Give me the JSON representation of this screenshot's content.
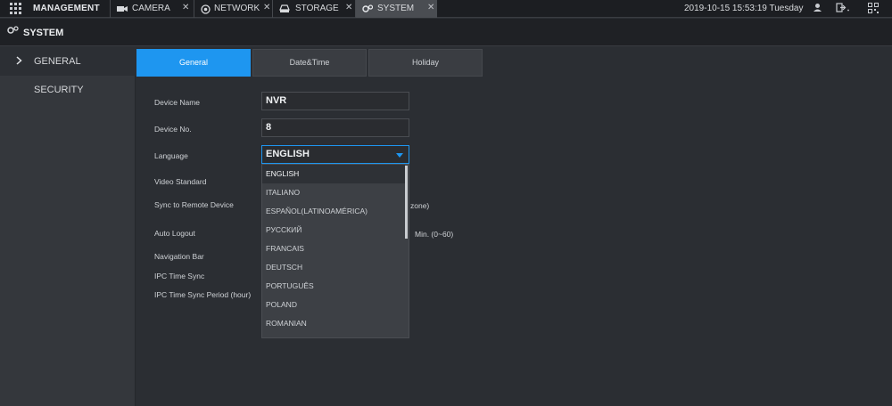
{
  "topbar": {
    "title": "MANAGEMENT",
    "tabs": [
      {
        "label": "CAMERA",
        "icon": "camera-icon",
        "close": "✕"
      },
      {
        "label": "NETWORK",
        "icon": "network-icon",
        "close": "✕"
      },
      {
        "label": "STORAGE",
        "icon": "storage-icon",
        "close": "✕"
      },
      {
        "label": "SYSTEM",
        "icon": "system-icon",
        "close": "✕",
        "active": true
      }
    ],
    "datetime": "2019-10-15 15:53:19 Tuesday"
  },
  "subbar": {
    "title": "SYSTEM"
  },
  "sidebar": {
    "items": [
      {
        "label": "GENERAL",
        "selected": true
      },
      {
        "label": "SECURITY",
        "selected": false
      }
    ]
  },
  "content_tabs": [
    {
      "label": "General",
      "active": true
    },
    {
      "label": "Date&Time",
      "active": false
    },
    {
      "label": "Holiday",
      "active": false
    }
  ],
  "form": {
    "device_name_label": "Device Name",
    "device_name_value": "NVR",
    "device_no_label": "Device No.",
    "device_no_value": "8",
    "language_label": "Language",
    "language_value": "ENGLISH",
    "video_standard_label": "Video Standard",
    "sync_remote_label": "Sync to Remote Device",
    "sync_remote_suffix": "zone)",
    "auto_logout_label": "Auto Logout",
    "auto_logout_suffix": "Min. (0~60)",
    "nav_bar_label": "Navigation Bar",
    "ipc_sync_label": "IPC Time Sync",
    "ipc_sync_period_label": "IPC Time Sync Period (hour)"
  },
  "language_options": [
    "ENGLISH",
    "ITALIANO",
    "ESPAÑOL(LATINOAMÉRICA)",
    "РУССКИЙ",
    "FRANCAIS",
    "DEUTSCH",
    "PORTUGUÊS",
    "POLAND",
    "ROMANIAN"
  ],
  "colors": {
    "accent": "#1e96f0",
    "background": "#2b2e33",
    "topbar": "#1c1e22"
  }
}
